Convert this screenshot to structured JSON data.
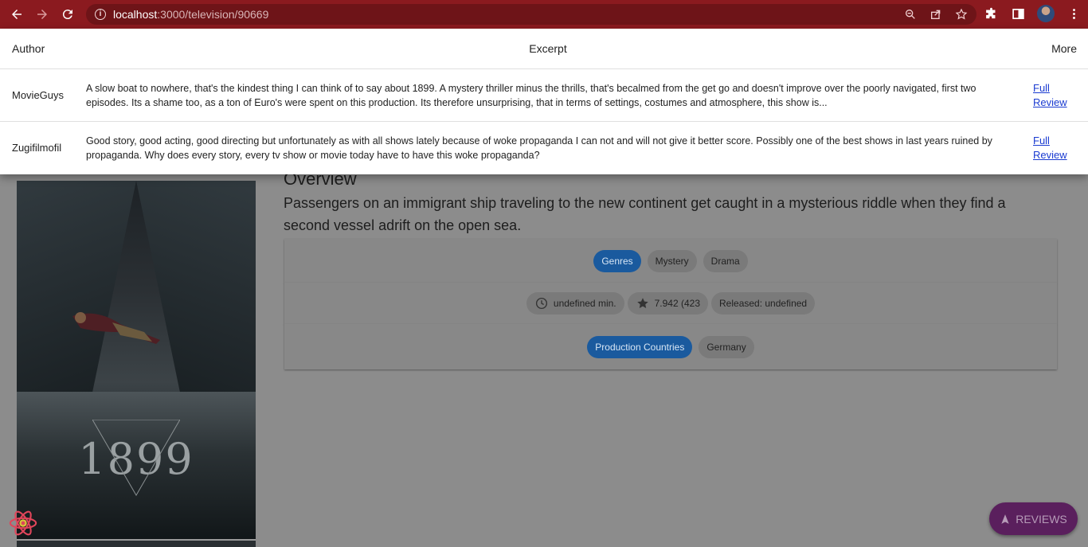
{
  "browser": {
    "url_host": "localhost",
    "url_path": ":3000/television/90669"
  },
  "reviews_table": {
    "headers": {
      "author": "Author",
      "excerpt": "Excerpt",
      "more": "More"
    },
    "rows": [
      {
        "author": "MovieGuys",
        "excerpt": "A slow boat to nowhere, that's the kindest thing I can think of to say about 1899. A mystery thriller minus the thrills, that's becalmed from the get go and doesn't improve over the poorly navigated, first two episodes. Its a shame too, as a ton of Euro's were spent on this production. Its therefore unsurprising, that in terms of settings, costumes and atmosphere, this show is...",
        "link_line1": "Full",
        "link_line2": "Review"
      },
      {
        "author": "Zugifilmofil",
        "excerpt": "Good story, good acting, good directing but unfortunately as with all shows lately because of woke propaganda I can not and will not give it better score. Possibly one of the best shows in last years ruined by propaganda. Why does every story, every tv show or movie today have to have this woke propaganda?",
        "link_line1": "Full",
        "link_line2": "Review"
      }
    ]
  },
  "poster": {
    "title_text": "1899"
  },
  "overview": {
    "heading": "Overview",
    "text": "Passengers on an immigrant ship traveling to the new continent get caught in a mysterious riddle when they find a second vessel adrift on the open sea."
  },
  "genres": {
    "label": "Genres",
    "items": [
      "Mystery",
      "Drama"
    ]
  },
  "stats": {
    "runtime": "undefined min.",
    "rating": "7.942 (423",
    "released": "Released: undefined"
  },
  "production": {
    "label": "Production Countries",
    "items": [
      "Germany"
    ]
  },
  "fab": {
    "label": "REVIEWS"
  },
  "icons": {
    "back": "arrow-left-icon",
    "forward": "arrow-right-icon",
    "reload": "reload-icon",
    "info": "info-icon",
    "zoom": "zoom-icon",
    "share": "share-icon",
    "star": "star-icon",
    "extensions": "puzzle-icon",
    "sidepanel": "side-panel-icon",
    "menu": "kebab-menu-icon",
    "clock": "clock-icon",
    "rating_star": "star-icon",
    "fab": "navigation-arrow-icon",
    "logo": "react-logo-icon"
  },
  "colors": {
    "browser_bar": "#8b1a1f",
    "chip_primary": "#1a5a9e",
    "fab": "#5a1f5d",
    "link": "#1a3bd1"
  }
}
